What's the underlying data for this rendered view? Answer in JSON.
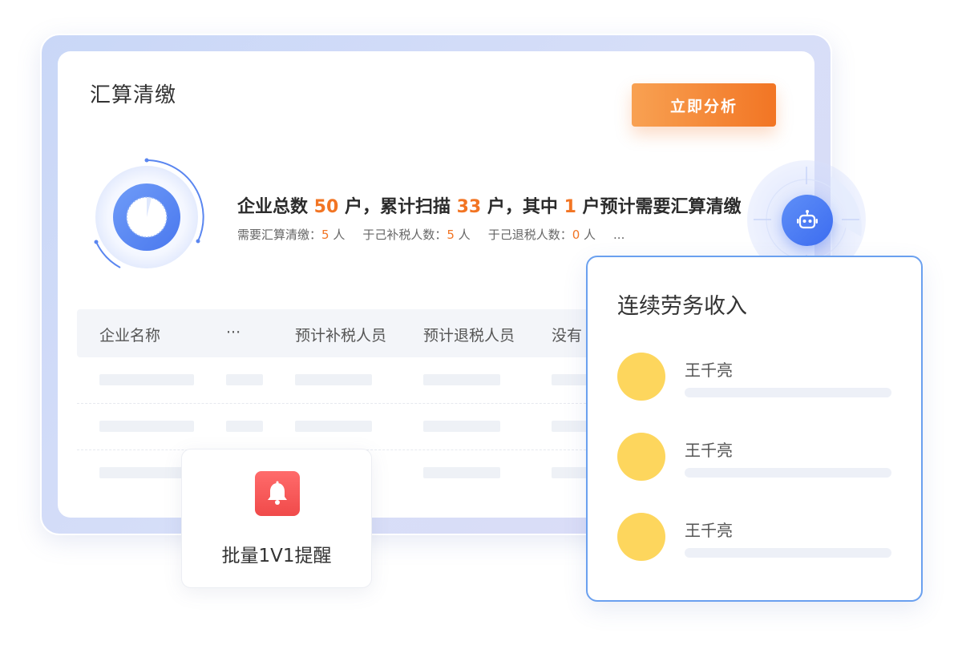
{
  "card": {
    "title": "汇算清缴",
    "analyze_button": "立即分析"
  },
  "summary": {
    "p1": "企业总数 ",
    "enterprise_total": "50",
    "p2": " 户，累计扫描 ",
    "scanned": "33",
    "p3": " 户，其中 ",
    "needed": "1",
    "p4": " 户预计需要汇算清缴",
    "sub_label_1": "需要汇算清缴：",
    "sub_value_1": "5",
    "sub_unit_1": " 人",
    "sub_label_2": "于己补税人数：",
    "sub_value_2": "5",
    "sub_unit_2": " 人",
    "sub_label_3": "于己退税人数：",
    "sub_value_3": "0",
    "sub_unit_3": " 人",
    "sub_more": "..."
  },
  "table": {
    "columns": [
      "企业名称",
      "···",
      "预计补税人员",
      "预计退税人员",
      "没有"
    ]
  },
  "reminder": {
    "label": "批量1V1提醒"
  },
  "income_panel": {
    "title": "连续劳务收入",
    "people": [
      {
        "name": "王千亮"
      },
      {
        "name": "王千亮"
      },
      {
        "name": "王千亮"
      }
    ]
  },
  "colors": {
    "accent_orange": "#f27524",
    "accent_blue": "#3c6cf0",
    "avatar_yellow": "#fdd65d",
    "alert_red": "#f04a4a"
  },
  "icons": {
    "robot": "robot-icon",
    "bell": "bell-icon",
    "progress": "progress-ring-icon"
  }
}
